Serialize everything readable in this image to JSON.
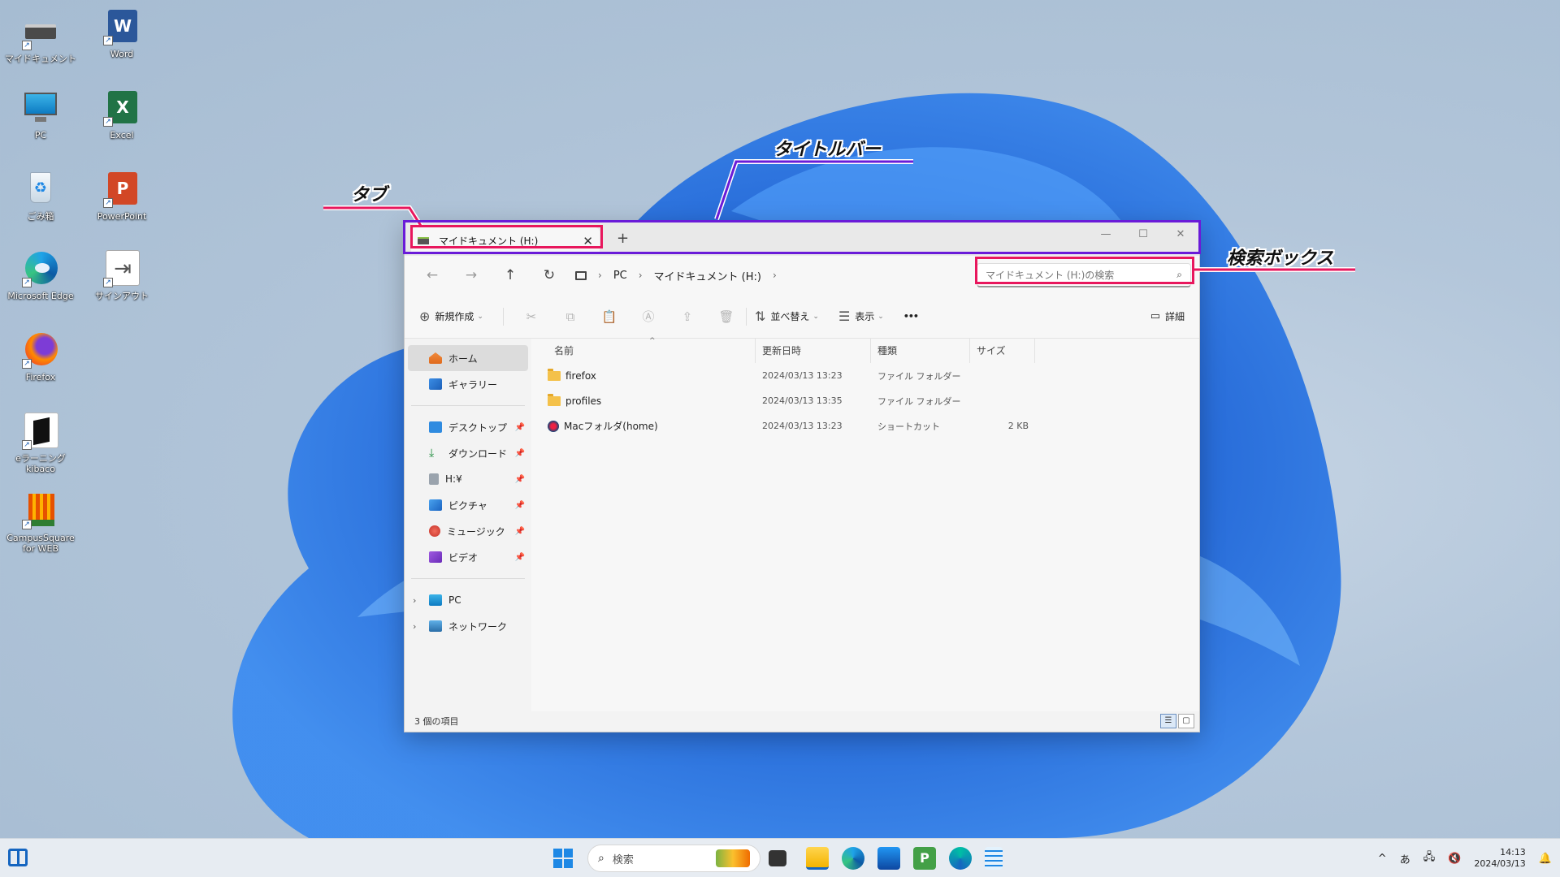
{
  "desktop": {
    "icons": [
      {
        "label": "マイドキュメント"
      },
      {
        "label": "Word"
      },
      {
        "label": "PC"
      },
      {
        "label": "Excel"
      },
      {
        "label": "ごみ箱"
      },
      {
        "label": "PowerPoint"
      },
      {
        "label": "Microsoft Edge"
      },
      {
        "label": "サインアウト"
      },
      {
        "label": "Firefox"
      },
      {
        "label": "eラーニングkibaco"
      },
      {
        "label": "CampusSquare for WEB"
      }
    ]
  },
  "annotations": {
    "tab_label": "タブ",
    "titlebar_label": "タイトルバー",
    "searchbox_label": "検索ボックス",
    "colors": {
      "tab": "#e8175d",
      "titlebar": "#6a1bd8",
      "search": "#e8175d"
    }
  },
  "explorer": {
    "tab_title": "マイドキュメント (H:)",
    "tab_close": "✕",
    "new_tab": "+",
    "window_controls": {
      "minimize": "—",
      "maximize": "☐",
      "close": "✕"
    },
    "nav": {
      "back": "←",
      "forward": "→",
      "up": "↑",
      "refresh": "↻"
    },
    "breadcrumb": [
      "PC",
      "マイドキュメント (H:)"
    ],
    "search_placeholder": "マイドキュメント (H:)の検索",
    "toolbar": {
      "new_label": "新規作成",
      "sort_label": "並べ替え",
      "view_label": "表示",
      "more_label": "•••",
      "details_label": "詳細"
    },
    "sidebar": {
      "home": "ホーム",
      "gallery": "ギャラリー",
      "quick": [
        {
          "label": "デスクトップ"
        },
        {
          "label": "ダウンロード"
        },
        {
          "label": "H:¥"
        },
        {
          "label": "ピクチャ"
        },
        {
          "label": "ミュージック"
        },
        {
          "label": "ビデオ"
        }
      ],
      "pc": "PC",
      "network": "ネットワーク"
    },
    "columns": {
      "name": "名前",
      "modified": "更新日時",
      "type": "種類",
      "size": "サイズ"
    },
    "files": [
      {
        "name": "firefox",
        "modified": "2024/03/13 13:23",
        "type": "ファイル フォルダー",
        "size": "",
        "icon": "folder-icon"
      },
      {
        "name": "profiles",
        "modified": "2024/03/13 13:35",
        "type": "ファイル フォルダー",
        "size": "",
        "icon": "folder-icon"
      },
      {
        "name": "Macフォルダ(home)",
        "modified": "2024/03/13 13:23",
        "type": "ショートカット",
        "size": "2 KB",
        "icon": "shortcut-icon"
      }
    ],
    "status": "3 個の項目"
  },
  "taskbar": {
    "search_placeholder": "検索",
    "ime": "あ",
    "time": "14:13",
    "date": "2024/03/13"
  }
}
